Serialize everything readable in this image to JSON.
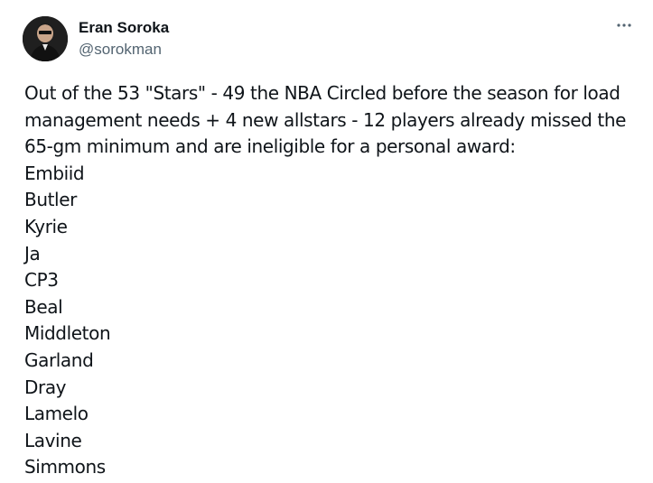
{
  "author": {
    "name": "Eran Soroka",
    "handle": "@sorokman"
  },
  "icons": {
    "avatar": "avatar-photo",
    "more": "more-horizontal-icon"
  },
  "tweet": {
    "intro": "Out of the 53 \"Stars\" - 49 the NBA Circled before the season for load management needs + 4 new allstars - 12 players already missed the 65-gm minimum and are ineligible for a personal award:",
    "players": [
      "Embiid",
      "Butler",
      "Kyrie",
      "Ja",
      "CP3",
      "Beal",
      "Middleton",
      "Garland",
      "Dray",
      "Lamelo",
      "Lavine",
      "Simmons"
    ]
  },
  "colors": {
    "text_primary": "#0f1419",
    "text_secondary": "#536471",
    "background": "#ffffff"
  }
}
